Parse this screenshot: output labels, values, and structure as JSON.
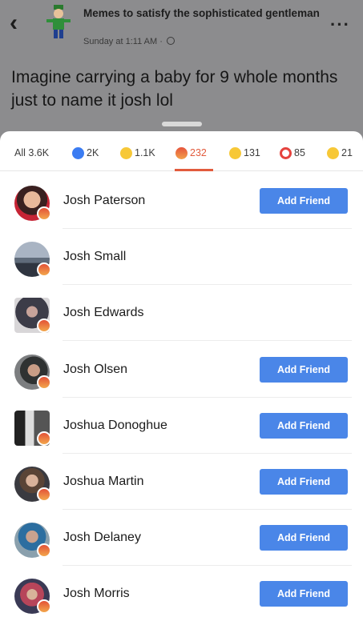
{
  "post": {
    "page_name": "Memes to satisfy the sophisticated gentleman",
    "time": "Sunday at 1:11 AM ·",
    "text": "Imagine carrying a baby for 9 whole months just to name it josh lol"
  },
  "tabs": [
    {
      "label": "All 3.6K",
      "icon": "none"
    },
    {
      "label": "2K",
      "icon": "like-reaction-icon"
    },
    {
      "label": "1.1K",
      "icon": "haha-reaction-icon"
    },
    {
      "label": "232",
      "icon": "angry-reaction-icon",
      "active": true
    },
    {
      "label": "131",
      "icon": "sad-reaction-icon"
    },
    {
      "label": "85",
      "icon": "love-reaction-icon"
    },
    {
      "label": "21",
      "icon": "wow-reaction-icon"
    }
  ],
  "people": [
    {
      "name": "Josh Paterson",
      "button": "Add Friend"
    },
    {
      "name": "Josh Small",
      "button": ""
    },
    {
      "name": "Josh Edwards",
      "button": ""
    },
    {
      "name": "Josh Olsen",
      "button": "Add Friend"
    },
    {
      "name": "Joshua Donoghue",
      "button": "Add Friend"
    },
    {
      "name": "Joshua Martin",
      "button": "Add Friend"
    },
    {
      "name": "Josh Delaney",
      "button": "Add Friend"
    },
    {
      "name": "Josh Morris",
      "button": "Add Friend"
    }
  ],
  "colors": {
    "accent": "#4a86e8",
    "active_tab": "#e25b3d"
  }
}
